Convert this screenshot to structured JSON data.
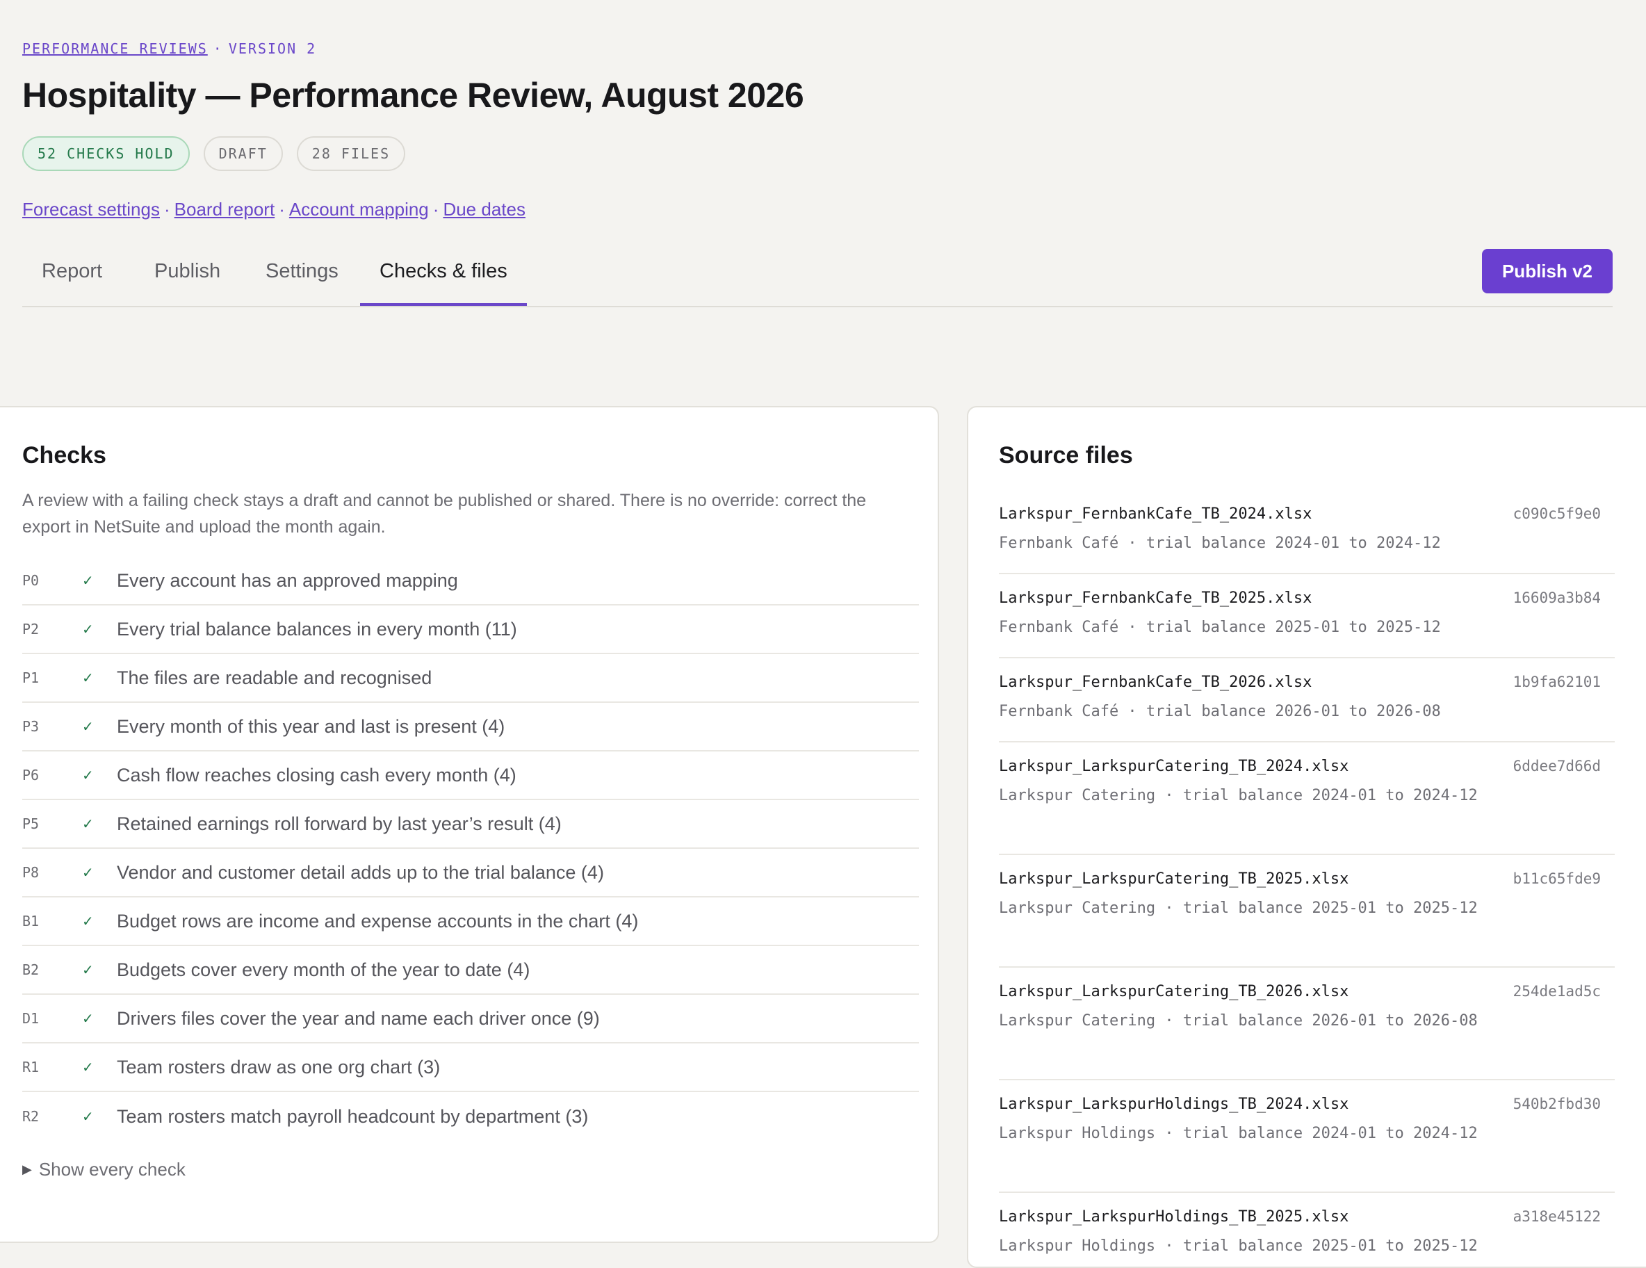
{
  "breadcrumb": {
    "parent": "PERFORMANCE REVIEWS",
    "separator": "·",
    "version": "VERSION 2"
  },
  "page": {
    "title": "Hospitality — Performance Review, August 2026"
  },
  "badges": {
    "checks": "52 CHECKS HOLD",
    "status": "DRAFT",
    "files": "28 FILES"
  },
  "links": [
    {
      "label": "Forecast settings"
    },
    {
      "label": "Board report"
    },
    {
      "label": "Account mapping"
    },
    {
      "label": "Due dates"
    }
  ],
  "link_separator": "·",
  "tabs": [
    {
      "label": "Report"
    },
    {
      "label": "Publish"
    },
    {
      "label": "Settings"
    },
    {
      "label": "Checks & files",
      "active": true
    }
  ],
  "publish_button": {
    "label": "Publish v2"
  },
  "checks": {
    "title": "Checks",
    "description": "A review with a failing check stays a draft and cannot be published or shared. There is no override: correct the export in NetSuite and upload the month again.",
    "check_glyph": "✓",
    "items": [
      {
        "code": "P0",
        "label": "Every account has an approved mapping"
      },
      {
        "code": "P2",
        "label": "Every trial balance balances in every month (11)"
      },
      {
        "code": "P1",
        "label": "The files are readable and recognised"
      },
      {
        "code": "P3",
        "label": "Every month of this year and last is present (4)"
      },
      {
        "code": "P6",
        "label": "Cash flow reaches closing cash every month (4)"
      },
      {
        "code": "P5",
        "label": "Retained earnings roll forward by last year’s result (4)"
      },
      {
        "code": "P8",
        "label": "Vendor and customer detail adds up to the trial balance (4)"
      },
      {
        "code": "B1",
        "label": "Budget rows are income and expense accounts in the chart (4)"
      },
      {
        "code": "B2",
        "label": "Budgets cover every month of the year to date (4)"
      },
      {
        "code": "D1",
        "label": "Drivers files cover the year and name each driver once (9)"
      },
      {
        "code": "R1",
        "label": "Team rosters draw as one org chart (3)"
      },
      {
        "code": "R2",
        "label": "Team rosters match payroll headcount by department (3)"
      }
    ],
    "show_all": "Show every check",
    "show_all_icon": "triangle-right"
  },
  "source_files": {
    "title": "Source files",
    "items": [
      {
        "name": "Larkspur_FernbankCafe_TB_2024.xlsx",
        "hash": "c090c5f9e0",
        "meta": "Fernbank Café · trial balance 2024-01 to 2024-12"
      },
      {
        "name": "Larkspur_FernbankCafe_TB_2025.xlsx",
        "hash": "16609a3b84",
        "meta": "Fernbank Café · trial balance 2025-01 to 2025-12"
      },
      {
        "name": "Larkspur_FernbankCafe_TB_2026.xlsx",
        "hash": "1b9fa62101",
        "meta": "Fernbank Café · trial balance 2026-01 to 2026-08"
      },
      {
        "name": "Larkspur_LarkspurCatering_TB_2024.xlsx",
        "hash": "6ddee7d66d",
        "meta": "Larkspur Catering · trial balance 2024-01 to 2024-12"
      },
      {
        "name": "Larkspur_LarkspurCatering_TB_2025.xlsx",
        "hash": "b11c65fde9",
        "meta": "Larkspur Catering · trial balance 2025-01 to 2025-12"
      },
      {
        "name": "Larkspur_LarkspurCatering_TB_2026.xlsx",
        "hash": "254de1ad5c",
        "meta": "Larkspur Catering · trial balance 2026-01 to 2026-08"
      },
      {
        "name": "Larkspur_LarkspurHoldings_TB_2024.xlsx",
        "hash": "540b2fbd30",
        "meta": "Larkspur Holdings · trial balance 2024-01 to 2024-12"
      },
      {
        "name": "Larkspur_LarkspurHoldings_TB_2025.xlsx",
        "hash": "a318e45122",
        "meta": "Larkspur Holdings · trial balance 2025-01 to 2025-12"
      }
    ]
  },
  "colors": {
    "accent": "#6a3fd0",
    "success": "#23794a",
    "background": "#f4f3f0"
  }
}
